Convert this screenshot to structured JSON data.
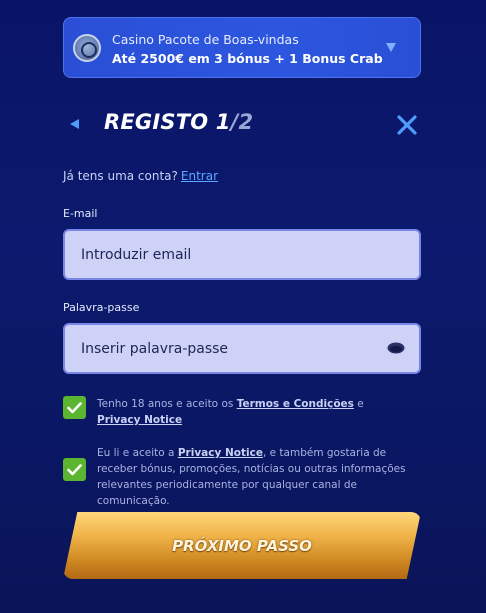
{
  "banner": {
    "title": "Casino Pacote de Boas-vindas",
    "subtitle": "Até 2500€ em 3 bónus + 1 Bonus Crab",
    "icon": "casino-chip-icon"
  },
  "header": {
    "title_prefix": "REGISTO ",
    "step_current": "1",
    "step_total": "/2"
  },
  "account": {
    "question": "Já tens uma conta?",
    "login_link": "Entrar"
  },
  "form": {
    "email_label": "E-mail",
    "email_placeholder": "Introduzir email",
    "password_label": "Palavra-passe",
    "password_placeholder": "Inserir palavra-passe"
  },
  "consents": {
    "terms_prefix": "Tenho 18 anos e aceito os ",
    "terms_link": "Termos e Condições",
    "terms_mid": " e ",
    "privacy_link": "Privacy Notice",
    "marketing_prefix": "Eu li e aceito a ",
    "marketing_link": "Privacy Notice",
    "marketing_rest": ", e também gostaria de receber bónus, promoções, notícias ou outras informações relevantes periodicamente por qualquer canal de comunicação."
  },
  "cta": {
    "label": "PRÓXIMO PASSO"
  },
  "colors": {
    "background": "#0b1a6e",
    "accent_blue": "#4f9cff",
    "checkbox_green": "#5bb531",
    "cta_gold": "#f0b44a"
  }
}
